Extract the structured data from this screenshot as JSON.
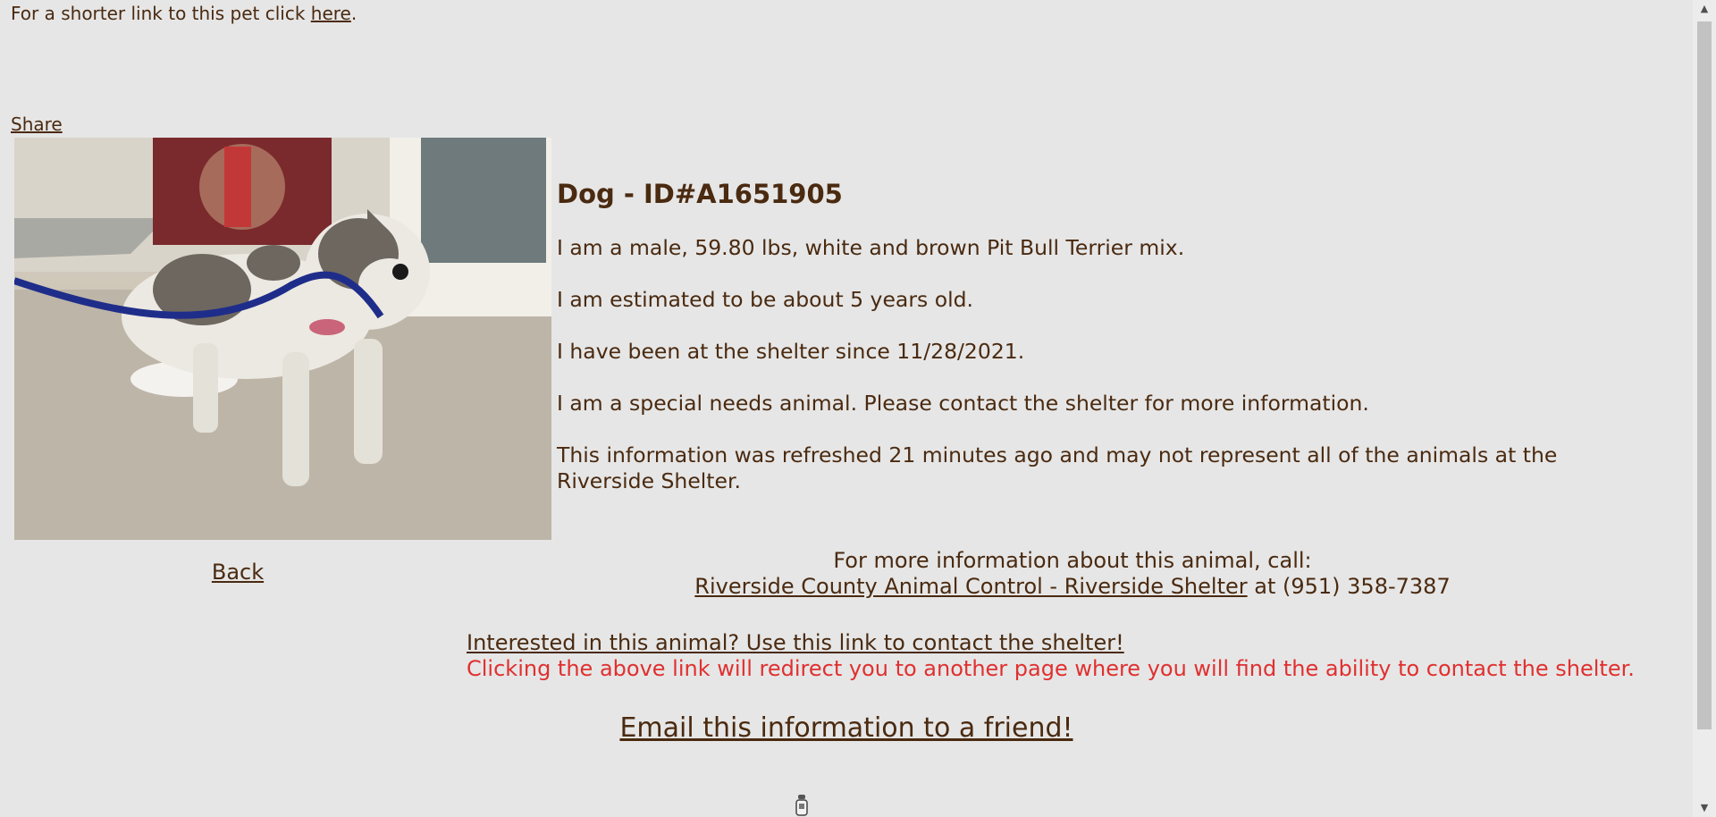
{
  "top": {
    "shortlink_prefix": "For a shorter link to this pet click ",
    "shortlink_link": "here",
    "shortlink_suffix": "."
  },
  "share_label": "Share",
  "pet": {
    "title": "Dog - ID#A1651905",
    "description": "I am a male, 59.80 lbs, white and brown Pit Bull Terrier mix.",
    "age": "I am estimated to be about 5 years old.",
    "since": "I have been at the shelter since 11/28/2021.",
    "special_needs": "I am a special needs animal. Please contact the shelter for more information.",
    "refresh_note": "This information was refreshed 21 minutes ago and may not represent all of the animals at the Riverside Shelter."
  },
  "back_label": "Back",
  "contact": {
    "intro": "For more information about this animal, call:",
    "shelter_link": "Riverside County Animal Control - Riverside Shelter",
    "phone_text": " at (951) 358-7387"
  },
  "interest": {
    "link": "Interested in this animal? Use this link to contact the shelter!",
    "note": "Clicking the above link will redirect you to another page where you will find the ability to contact the shelter."
  },
  "email_label": "Email this information to a friend!",
  "icons": {
    "photo": "dog-photo",
    "spinner": "loading-icon",
    "scroll_up": "chevron-up-icon",
    "scroll_down": "chevron-down-icon"
  },
  "colors": {
    "background": "#e6e6e6",
    "text": "#4a2a10",
    "warning": "#e03030"
  }
}
